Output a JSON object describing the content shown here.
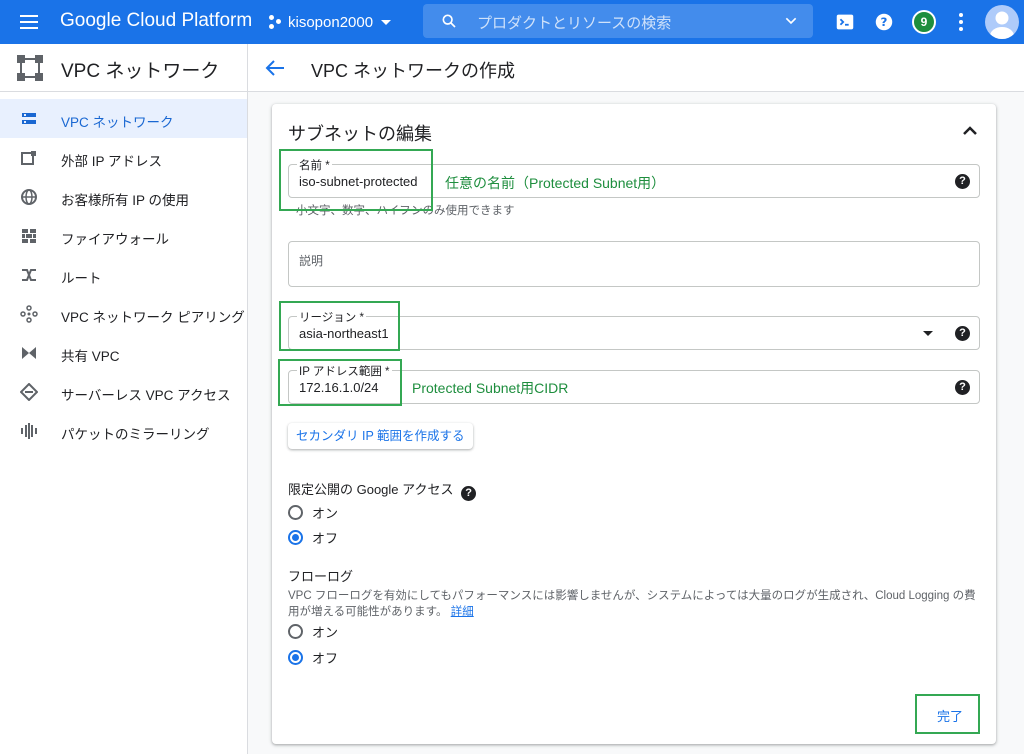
{
  "topbar": {
    "brand": "Google Cloud Platform",
    "project": "kisopon2000",
    "search_placeholder": "プロダクトとリソースの検索",
    "notification_count": "9"
  },
  "sidebar": {
    "title": "VPC ネットワーク",
    "items": [
      {
        "label": "VPC ネットワーク",
        "icon": "vpc-network-icon",
        "active": true
      },
      {
        "label": "外部 IP アドレス",
        "icon": "external-ip-icon"
      },
      {
        "label": "お客様所有 IP の使用",
        "icon": "globe-icon"
      },
      {
        "label": "ファイアウォール",
        "icon": "firewall-icon"
      },
      {
        "label": "ルート",
        "icon": "route-icon"
      },
      {
        "label": "VPC ネットワーク ピアリング",
        "icon": "peering-icon"
      },
      {
        "label": "共有 VPC",
        "icon": "shared-vpc-icon"
      },
      {
        "label": "サーバーレス VPC アクセス",
        "icon": "serverless-icon"
      },
      {
        "label": "パケットのミラーリング",
        "icon": "packet-mirroring-icon"
      }
    ]
  },
  "page": {
    "title": "VPC ネットワークの作成"
  },
  "subnet": {
    "section_title": "サブネットの編集",
    "name": {
      "label": "名前 *",
      "value": "iso-subnet-protected",
      "hint": "小文字、数字、ハイフンのみ使用できます",
      "annotation": "任意の名前（Protected Subnet用）"
    },
    "description": {
      "placeholder": "説明"
    },
    "region": {
      "label": "リージョン *",
      "value": "asia-northeast1"
    },
    "ip_range": {
      "label": "IP アドレス範囲 *",
      "value": "172.16.1.0/24",
      "annotation": "Protected Subnet用CIDR"
    },
    "secondary_button": "セカンダリ IP 範囲を作成する",
    "private_google_access": {
      "title": "限定公開の Google アクセス",
      "on": "オン",
      "off": "オフ",
      "selected": "off"
    },
    "flow_logs": {
      "title": "フローログ",
      "description": "VPC フローログを有効にしてもパフォーマンスには影響しませんが、システムによっては大量のログが生成され、Cloud Logging の費用が増える可能性があります。",
      "details_link": "詳細",
      "on": "オン",
      "off": "オフ",
      "selected": "off"
    },
    "done_button": "完了"
  },
  "colors": {
    "header_blue": "#1a73e8",
    "annotation_green": "#34a853",
    "active_bg": "#e8f0fe"
  }
}
